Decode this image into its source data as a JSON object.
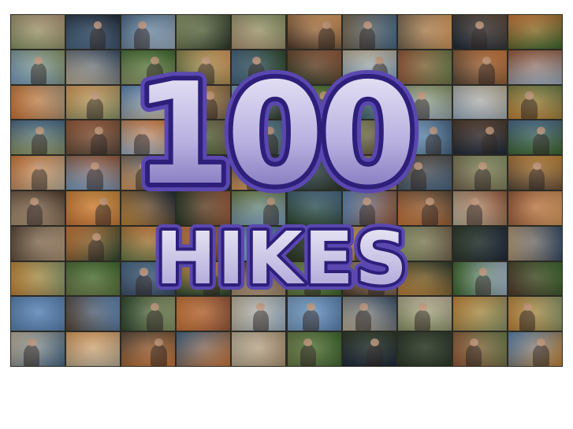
{
  "title": {
    "number": "100",
    "word": "HIKES"
  },
  "collage": {
    "columns": 10,
    "rows": 10,
    "tile_palette": [
      "#c98a3a",
      "#3f6a2e",
      "#5d87b8",
      "#7a6a52",
      "#2d3a28",
      "#a3b6c9",
      "#5c4a3a",
      "#d27a3a",
      "#4a6b8a",
      "#8e9a6a",
      "#1f2a3a",
      "#b59a7a",
      "#6e7f4a",
      "#3a4f6a",
      "#9a5a3a",
      "#c4b8a0",
      "#2e4a2e",
      "#7da3c9",
      "#513b2c",
      "#e0a060"
    ]
  },
  "colors": {
    "number_fill_top": "#e9e6f5",
    "number_fill_bottom": "#7d70b8",
    "number_outline": "#2e1f7a",
    "number_outline_outer": "#5a48b0",
    "background": "#ffffff"
  }
}
